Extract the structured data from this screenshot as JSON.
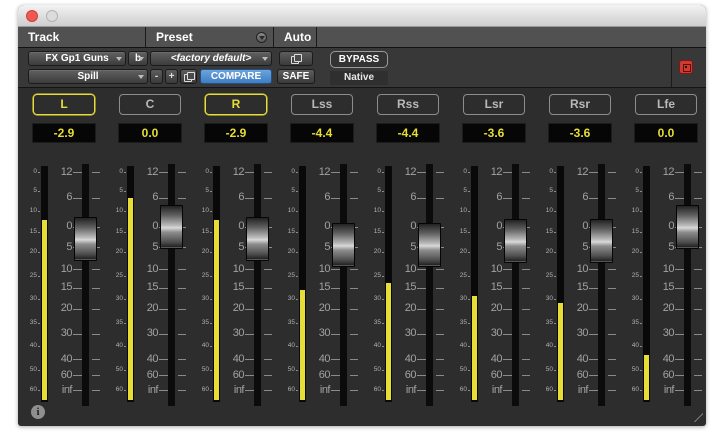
{
  "titlebar": {
    "buttons": [
      "close",
      "minimize"
    ]
  },
  "header": {
    "track": {
      "label": "Track",
      "track_name": "FX Gp1 Guns",
      "bus": "b",
      "view_mode": "Spill"
    },
    "preset": {
      "label": "Preset",
      "preset_name": "<factory default>",
      "minus": "-",
      "plus": "+",
      "compare": "COMPARE"
    },
    "auto": {
      "label": "Auto",
      "safe": "SAFE"
    },
    "bypass_label": "BYPASS",
    "engine_label": "Native"
  },
  "fader_scale": [
    "12",
    "6",
    "0",
    "5",
    "10",
    "15",
    "20",
    "30",
    "40",
    "60",
    "inf"
  ],
  "meter_scale": [
    "0",
    "5",
    "10",
    "15",
    "20",
    "25",
    "30",
    "35",
    "40",
    "50",
    "60"
  ],
  "channels": [
    {
      "label": "L",
      "value": "-2.9",
      "selected": true,
      "fader_db": -2.9,
      "meter_pct": 78
    },
    {
      "label": "C",
      "value": "0.0",
      "selected": false,
      "fader_db": 0,
      "meter_pct": 88
    },
    {
      "label": "R",
      "value": "-2.9",
      "selected": true,
      "fader_db": -2.9,
      "meter_pct": 78
    },
    {
      "label": "Lss",
      "value": "-4.4",
      "selected": false,
      "fader_db": -4.4,
      "meter_pct": 46
    },
    {
      "label": "Rss",
      "value": "-4.4",
      "selected": false,
      "fader_db": -4.4,
      "meter_pct": 49
    },
    {
      "label": "Lsr",
      "value": "-3.6",
      "selected": false,
      "fader_db": -3.6,
      "meter_pct": 43
    },
    {
      "label": "Rsr",
      "value": "-3.6",
      "selected": false,
      "fader_db": -3.6,
      "meter_pct": 40
    },
    {
      "label": "Lfe",
      "value": "0.0",
      "selected": false,
      "fader_db": 0,
      "meter_pct": 16
    }
  ],
  "info_icon": "i",
  "colors": {
    "accent_yellow": "#e6de36",
    "compare_blue": "#3f7dc2",
    "compare_blue_light": "#6ba4df",
    "target_red": "#cf3a31"
  }
}
